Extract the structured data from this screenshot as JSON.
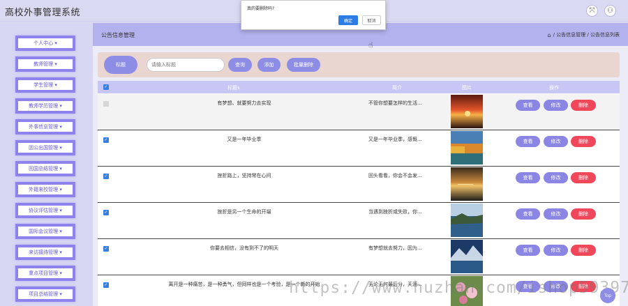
{
  "app": {
    "title": "高校外事管理系统"
  },
  "topbar": {
    "icons": [
      "expand-icon",
      "user-icon"
    ]
  },
  "sidebar": {
    "items": [
      {
        "label": "个人中心"
      },
      {
        "label": "教师管理"
      },
      {
        "label": "学生管理"
      },
      {
        "label": "教师学历管理"
      },
      {
        "label": "外事信息管理"
      },
      {
        "label": "因公出国管理"
      },
      {
        "label": "回国总结管理"
      },
      {
        "label": "外籍来校管理"
      },
      {
        "label": "协议评估管理"
      },
      {
        "label": "国际会议管理"
      },
      {
        "label": "来访接待管理"
      },
      {
        "label": "重点项目管理"
      },
      {
        "label": "项目总结管理"
      }
    ]
  },
  "breadcrumb": {
    "title": "公告信息管理",
    "path": "/ 公告信息管理 / 公告信息列表"
  },
  "search": {
    "label": "标题",
    "placeholder": "请输入标题",
    "query_btn": "查询",
    "add_btn": "添加",
    "batch_delete_btn": "批量删除"
  },
  "table": {
    "headers": {
      "title": "标题",
      "desc": "简介",
      "image": "图片",
      "action": "操作"
    },
    "rows": [
      {
        "title": "有梦想、就要努力去实现",
        "desc": "不管你想要怎样的生活...",
        "checked": false
      },
      {
        "title": "又是一年毕业季",
        "desc": "又是一年毕业季，感慨...",
        "checked": true
      },
      {
        "title": "挫折路上，坚持常在心间",
        "desc": "回头看看，你会不会发...",
        "checked": true
      },
      {
        "title": "挫折是另一个生命的开端",
        "desc": "当遇到挫折或失败，你...",
        "checked": true
      },
      {
        "title": "你要去相信，没有到不了的明天",
        "desc": "有梦想就去努力，因为...",
        "checked": true
      },
      {
        "title": "离开是一种痛苦，是一种勇气，但同样也是一个考验，是一个新的开始",
        "desc": "无论无何最后分，天涯...",
        "checked": true
      }
    ],
    "actions": {
      "view": "查看",
      "edit": "修改",
      "delete": "删除"
    }
  },
  "dialog": {
    "message": "真的要删除吗?",
    "ok": "确定",
    "cancel": "取消"
  },
  "back_to_top": "Top",
  "watermark": "https://www.huzhan.com/ishop59397",
  "colors": {
    "accent": "#8e8de6",
    "danger": "#f0475b",
    "nav_border": "#8e83ec",
    "header_bar": "#b3b2ee"
  }
}
